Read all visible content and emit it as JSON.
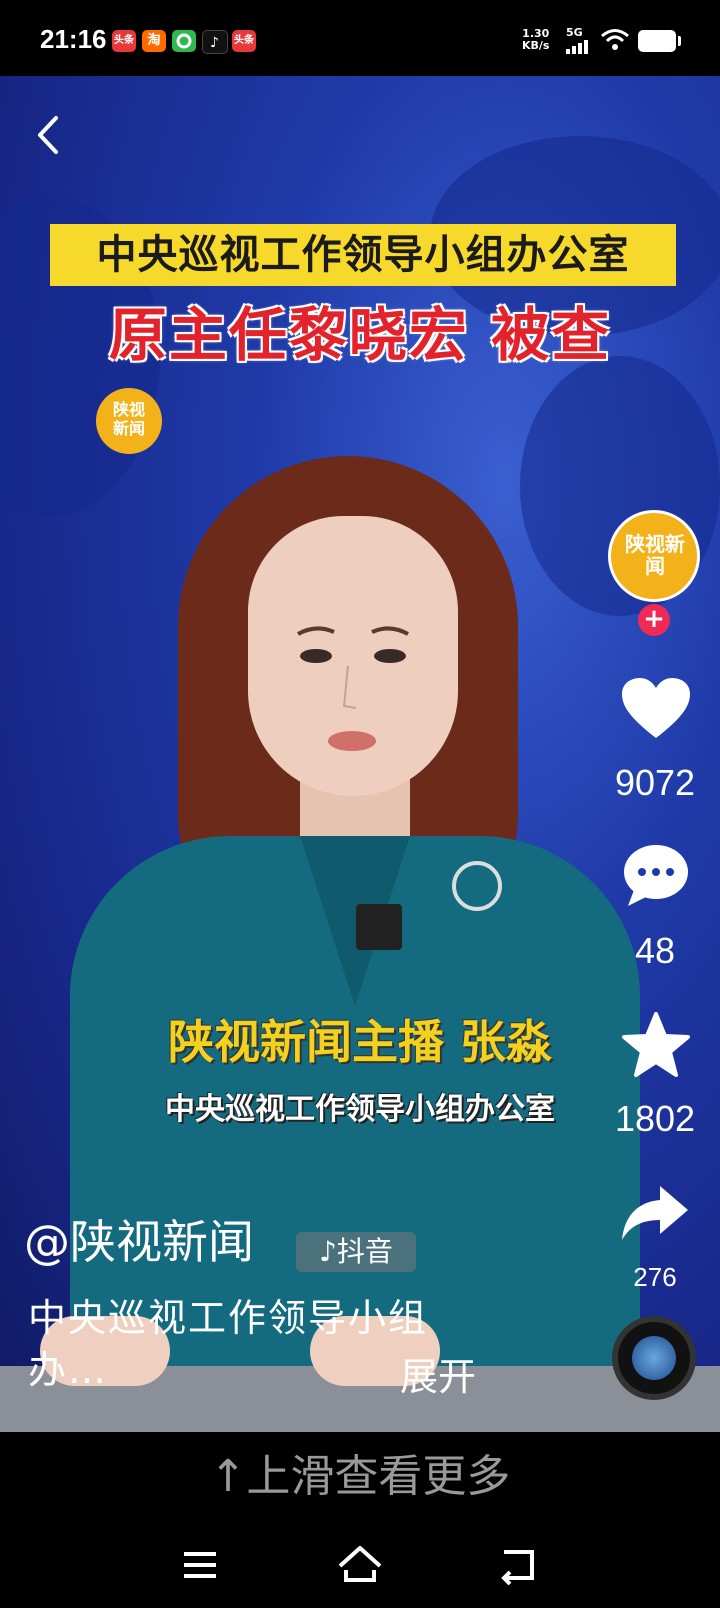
{
  "status_bar": {
    "time": "21:16",
    "notification_icons": [
      {
        "name": "toutiao-icon",
        "label": "头条",
        "color": "#e8393a"
      },
      {
        "name": "taobao-icon",
        "label": "淘",
        "color": "#ff6a00"
      },
      {
        "name": "app-green-icon",
        "label": "",
        "color": "#2eb84f"
      },
      {
        "name": "douyin-icon",
        "label": "",
        "color": "#111111"
      },
      {
        "name": "toutiao-icon-2",
        "label": "头条",
        "color": "#e8393a"
      }
    ],
    "network_speed": "1.30",
    "network_unit": "KB/s",
    "signal_type": "5G"
  },
  "video": {
    "headline_line1": "中央巡视工作领导小组办公室",
    "headline_line2": "原主任黎晓宏 被查",
    "watermark_logo": "陕视新闻",
    "caption_line1": "陕视新闻主播 张淼",
    "caption_line2": "中央巡视工作领导小组办公室"
  },
  "actions": {
    "avatar_label": "陕视新闻",
    "follow_symbol": "+",
    "likes": "9072",
    "comments": "48",
    "favorites": "1802",
    "shares": "276"
  },
  "info": {
    "author": "@陕视新闻",
    "platform_tag": "抖音",
    "description": "中央巡视工作领导小组办…",
    "expand_label": "展开"
  },
  "bottom": {
    "swipe_hint": "↑上滑查看更多"
  },
  "colors": {
    "accent_yellow": "#f6d92b",
    "headline_red": "#e3232c",
    "follow_pink": "#f02a55"
  }
}
